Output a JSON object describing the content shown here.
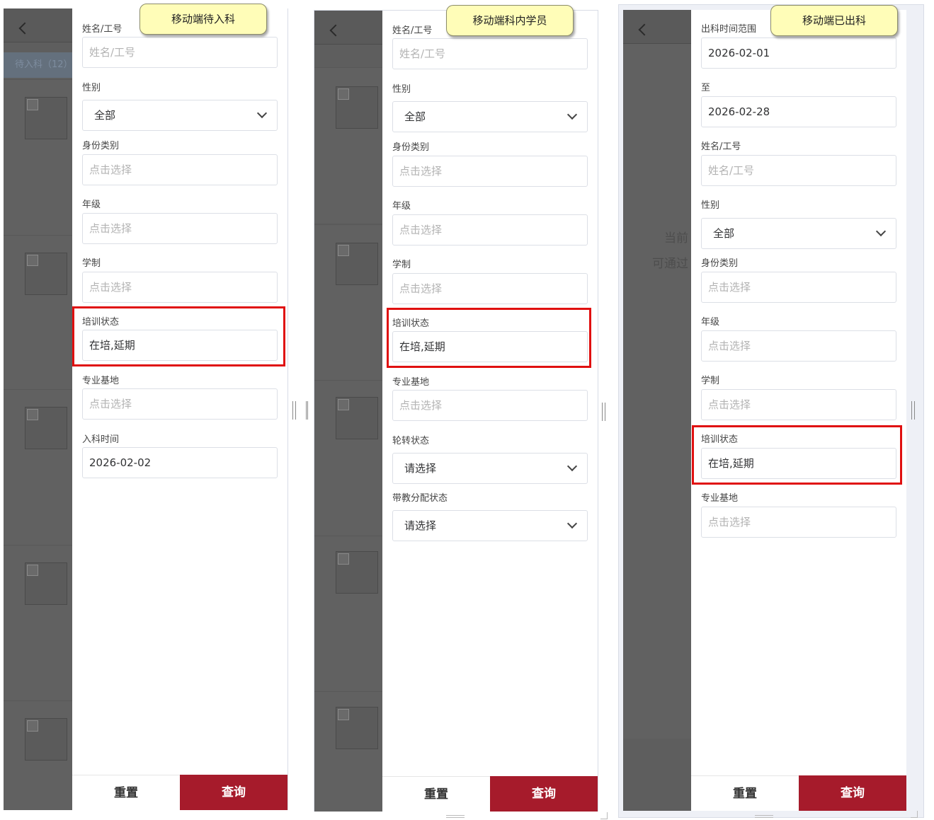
{
  "colors": {
    "query_button": "#a61b2b",
    "highlight": "#e01010",
    "callout_bg": "#fffdb8",
    "overlay_bg": "#5e5e5e"
  },
  "panels": [
    {
      "callout": "移动端待入科",
      "tab_label": "待入科（12）",
      "fields": [
        {
          "label": "姓名/工号",
          "value": "",
          "placeholder": "姓名/工号"
        },
        {
          "label": "性别",
          "value": "全部",
          "placeholder": ""
        },
        {
          "label": "身份类别",
          "value": "",
          "placeholder": "点击选择"
        },
        {
          "label": "年级",
          "value": "",
          "placeholder": "点击选择"
        },
        {
          "label": "学制",
          "value": "",
          "placeholder": "点击选择"
        },
        {
          "label": "培训状态",
          "value": "在培,延期",
          "placeholder": ""
        },
        {
          "label": "专业基地",
          "value": "",
          "placeholder": "点击选择"
        },
        {
          "label": "入科时间",
          "value": "2026-02-02",
          "placeholder": ""
        }
      ],
      "reset_label": "重置",
      "query_label": "查询"
    },
    {
      "callout": "移动端科内学员",
      "fields": [
        {
          "label": "姓名/工号",
          "value": "",
          "placeholder": "姓名/工号"
        },
        {
          "label": "性别",
          "value": "全部",
          "placeholder": ""
        },
        {
          "label": "身份类别",
          "value": "",
          "placeholder": "点击选择"
        },
        {
          "label": "年级",
          "value": "",
          "placeholder": "点击选择"
        },
        {
          "label": "学制",
          "value": "",
          "placeholder": "点击选择"
        },
        {
          "label": "培训状态",
          "value": "在培,延期",
          "placeholder": ""
        },
        {
          "label": "专业基地",
          "value": "",
          "placeholder": "点击选择"
        },
        {
          "label": "轮转状态",
          "value": "请选择",
          "placeholder": ""
        },
        {
          "label": "带教分配状态",
          "value": "请选择",
          "placeholder": ""
        }
      ],
      "reset_label": "重置",
      "query_label": "查询"
    },
    {
      "callout": "移动端已出科",
      "empty_line1": "当前",
      "empty_line2": "可通过",
      "fields": [
        {
          "label": "出科时间范围",
          "value": "2026-02-01",
          "placeholder": ""
        },
        {
          "label": "至",
          "value": "2026-02-28",
          "placeholder": ""
        },
        {
          "label": "姓名/工号",
          "value": "",
          "placeholder": "姓名/工号"
        },
        {
          "label": "性别",
          "value": "全部",
          "placeholder": ""
        },
        {
          "label": "身份类别",
          "value": "",
          "placeholder": "点击选择"
        },
        {
          "label": "年级",
          "value": "",
          "placeholder": "点击选择"
        },
        {
          "label": "学制",
          "value": "",
          "placeholder": "点击选择"
        },
        {
          "label": "培训状态",
          "value": "在培,延期",
          "placeholder": ""
        },
        {
          "label": "专业基地",
          "value": "",
          "placeholder": "点击选择"
        }
      ],
      "reset_label": "重置",
      "query_label": "查询"
    }
  ]
}
